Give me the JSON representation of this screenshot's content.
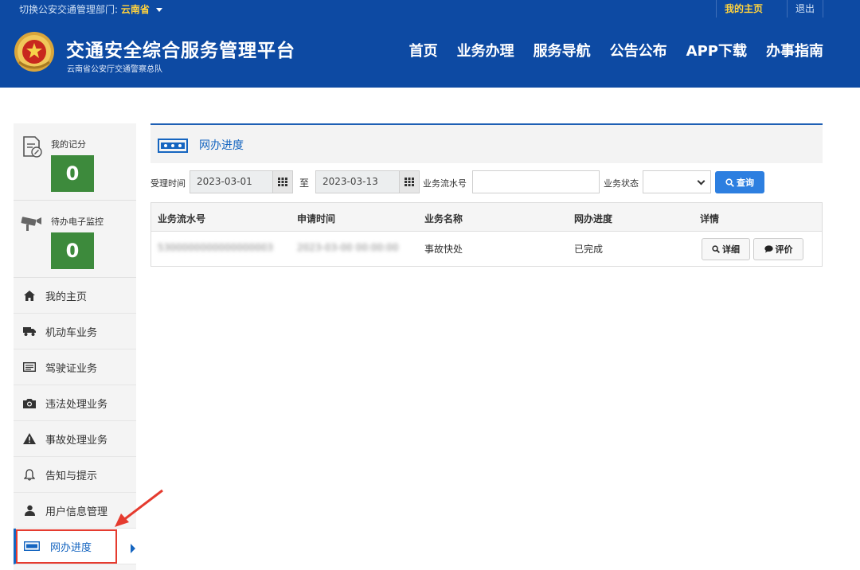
{
  "topbar": {
    "dept_prefix": "切换公安交通管理部门:",
    "dept_name": "云南省",
    "my_home": "我的主页",
    "logout": "退出"
  },
  "header": {
    "title": "交通安全综合服务管理平台",
    "subtitle": "云南省公安厅交通警察总队",
    "nav": [
      "首页",
      "业务办理",
      "服务导航",
      "公告公布",
      "APP下载",
      "办事指南"
    ]
  },
  "sidebar": {
    "score_label": "我的记分",
    "score_value": "0",
    "monitor_label": "待办电子监控",
    "monitor_value": "0",
    "items": [
      {
        "label": "我的主页",
        "icon": "home-icon"
      },
      {
        "label": "机动车业务",
        "icon": "truck-icon"
      },
      {
        "label": "驾驶证业务",
        "icon": "id-card-icon"
      },
      {
        "label": "违法处理业务",
        "icon": "camera-icon"
      },
      {
        "label": "事故处理业务",
        "icon": "warning-icon"
      },
      {
        "label": "告知与提示",
        "icon": "bell-icon"
      },
      {
        "label": "用户信息管理",
        "icon": "user-icon"
      },
      {
        "label": "网办进度",
        "icon": "progress-icon",
        "active": true
      }
    ]
  },
  "main": {
    "panel_title": "网办进度",
    "filters": {
      "time_label": "受理时间",
      "date_from": "2023-03-01",
      "to_label": "至",
      "date_to": "2023-03-13",
      "serial_label": "业务流水号",
      "serial_value": "",
      "status_label": "业务状态",
      "status_value": "",
      "query_label": "查询"
    },
    "table": {
      "headers": [
        "业务流水号",
        "申请时间",
        "业务名称",
        "网办进度",
        "详情"
      ],
      "rows": [
        {
          "serial": "5300000000000000003",
          "time": "2023-03-00 00:00:00",
          "name": "事故快处",
          "progress": "已完成",
          "detail_label": "详细",
          "review_label": "评价"
        }
      ]
    }
  },
  "colors": {
    "header_bg": "#0d4aa3",
    "accent": "#1565c0",
    "score_green": "#3d8a3c",
    "query_blue": "#2d7fe0",
    "highlight_red": "#e53b2f"
  }
}
